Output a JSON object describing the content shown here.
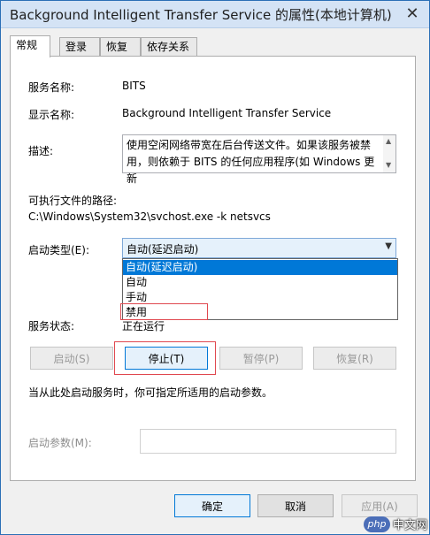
{
  "window": {
    "title": "Background Intelligent Transfer Service 的属性(本地计算机)",
    "close_glyph": "✕"
  },
  "tabs": [
    {
      "label": "常规"
    },
    {
      "label": "登录"
    },
    {
      "label": "恢复"
    },
    {
      "label": "依存关系"
    }
  ],
  "general": {
    "service_name_label": "服务名称:",
    "service_name_value": "BITS",
    "display_name_label": "显示名称:",
    "display_name_value": "Background Intelligent Transfer Service",
    "description_label": "描述:",
    "description_value": "使用空闲网络带宽在后台传送文件。如果该服务被禁用，则依赖于 BITS 的任何应用程序(如 Windows 更新",
    "exe_path_label": "可执行文件的路径:",
    "exe_path_value": "C:\\Windows\\System32\\svchost.exe -k netsvcs",
    "startup_type_label": "启动类型(E):",
    "startup_type_selected": "自动(延迟启动)",
    "startup_options": [
      "自动(延迟启动)",
      "自动",
      "手动",
      "禁用"
    ],
    "service_status_label": "服务状态:",
    "service_status_value": "正在运行",
    "start_button": "启动(S)",
    "stop_button": "停止(T)",
    "pause_button": "暂停(P)",
    "resume_button": "恢复(R)",
    "hint_text": "当从此处启动服务时，你可指定所适用的启动参数。",
    "start_params_label": "启动参数(M):",
    "start_params_value": ""
  },
  "footer": {
    "ok": "确定",
    "cancel": "取消",
    "apply": "应用(A)"
  },
  "watermark": {
    "logo": "php",
    "text": "中文网"
  },
  "colors": {
    "accent": "#0078d7",
    "highlight": "#e0484f",
    "title_bar": "#d4e3f5"
  }
}
